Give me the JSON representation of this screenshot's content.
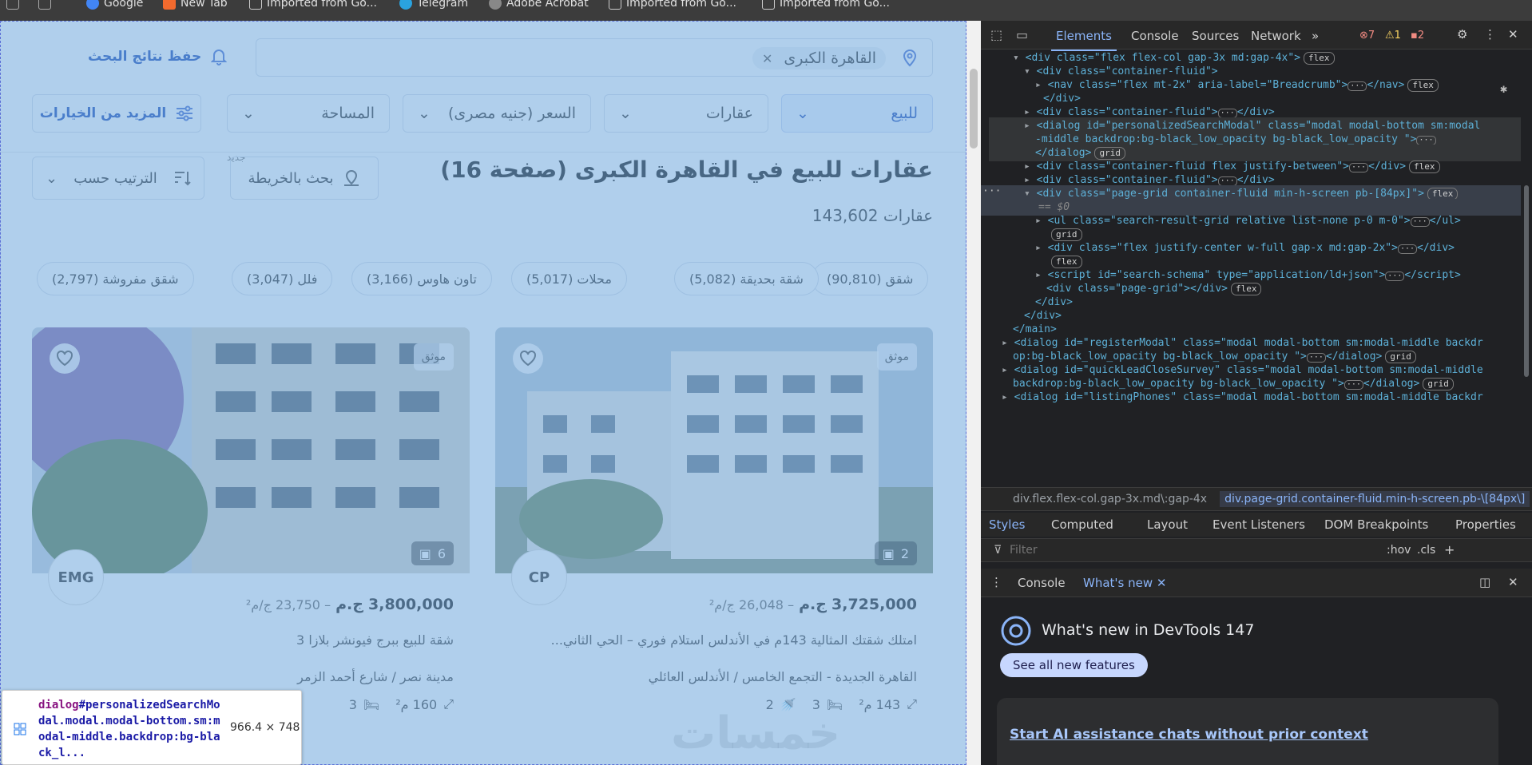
{
  "bookmarks": [
    "Google",
    "New Tab",
    "Imported from Go...",
    "Telegram",
    "Adobe Acrobat",
    "Imported from Go...",
    "Imported from Go..."
  ],
  "search": {
    "location_chip": "القاهرة الكبرى",
    "save_label": "حفظ نتائج البحث"
  },
  "filters": {
    "purpose": "للبيع",
    "type": "عقارات",
    "price": "السعر (جنيه مصرى)",
    "area": "المساحة",
    "more": "المزيد من الخيارات"
  },
  "results": {
    "title": "عقارات للبيع في القاهرة الكبرى (صفحة 16)",
    "count": "143,602 عقارات",
    "map_search": "بحث بالخريطة",
    "new_tag": "جديد",
    "sort": "الترتيب حسب"
  },
  "categories": [
    "شقق (90,810)",
    "شقة بحديقة (5,082)",
    "محلات (5,017)",
    "تاون هاوس (3,166)",
    "فلل (3,047)",
    "شقق مفروشة (2,797)"
  ],
  "listings": [
    {
      "badge": "موثق",
      "images": "2",
      "price": "3,725,000",
      "currency": "ج.م",
      "ppm": "– 26,048 ج/م²",
      "desc": "امتلك شقتك المثالية 143م في الأندلس استلام فوري – الحي الثاني...",
      "location": "القاهرة الجديدة - التجمع الخامس / الأندلس العائلي",
      "area": "143 م²",
      "beds": "3",
      "baths": "2",
      "logo": "CP"
    },
    {
      "badge": "موثق",
      "images": "6",
      "price": "3,800,000",
      "currency": "ج.م",
      "ppm": "– 23,750 ج/م²",
      "desc": "شقة للبيع ببرج فيونشر بلازا 3",
      "location": "مدينة نصر / شارع أحمد الزمر",
      "area": "160 م²",
      "beds": "3",
      "baths": "",
      "logo": "EMG"
    }
  ],
  "watermark": "خمسات",
  "inspect_tooltip": {
    "tag": "dialog",
    "selector": "#personalizedSearchModal.modal.modal-bottom.sm:modal-middle.backdrop:bg-black_l...",
    "size": "966.4 × 748"
  },
  "devtools": {
    "tabs": [
      "Elements",
      "Console",
      "Sources",
      "Network"
    ],
    "errors": "7",
    "warnings": "1",
    "issues": "2",
    "tree": [
      "<div class=\"flex flex-col gap-3x md:gap-4x\">",
      "<div class=\"container-fluid\">",
      "<nav class=\"flex mt-2x\" aria-label=\"Breadcrumb\">",
      "</div>",
      "<div class=\"container-fluid\">",
      "<dialog id=\"personalizedSearchModal\" class=\"modal modal-bottom sm:modal",
      "-middle backdrop:bg-black_low_opacity  bg-black_low_opacity  \">",
      "</dialog>",
      "<div class=\"container-fluid flex justify-between\">",
      "<div class=\"container-fluid\">",
      "<div class=\"page-grid container-fluid min-h-screen pb-[84px]\">",
      "== $0",
      "<ul class=\"search-result-grid relative list-none p-0 m-0\">",
      "<div class=\"flex justify-center w-full gap-x md:gap-2x\">",
      "<script id=\"search-schema\" type=\"application/ld+json\">",
      "<div class=\"page-grid\"></div>",
      "</div>",
      "</div>",
      "</main>",
      "<dialog id=\"registerModal\" class=\"modal modal-bottom sm:modal-middle backdr",
      "op:bg-black_low_opacity  bg-black_low_opacity  \">",
      "<dialog id=\"quickLeadCloseSurvey\" class=\"modal modal-bottom sm:modal-middle",
      "backdrop:bg-black_low_opacity  bg-black_low_opacity  \">",
      "<dialog id=\"listingPhones\" class=\"modal modal-bottom sm:modal-middle backdr"
    ],
    "crumbs": [
      "div.flex.flex-col.gap-3x.md\\:gap-4x",
      "div.page-grid.container-fluid.min-h-screen.pb-\\[84px\\]"
    ],
    "style_tabs": [
      "Styles",
      "Computed",
      "Layout",
      "Event Listeners",
      "DOM Breakpoints",
      "Properties"
    ],
    "filter_placeholder": "Filter",
    "filter_tools": [
      ":hov",
      ".cls"
    ],
    "drawer_tabs": [
      "Console",
      "What's new"
    ],
    "whats_new_title": "What's new in DevTools 147",
    "see_all": "See all new features",
    "ai_link": "Start AI assistance chats without prior context"
  }
}
